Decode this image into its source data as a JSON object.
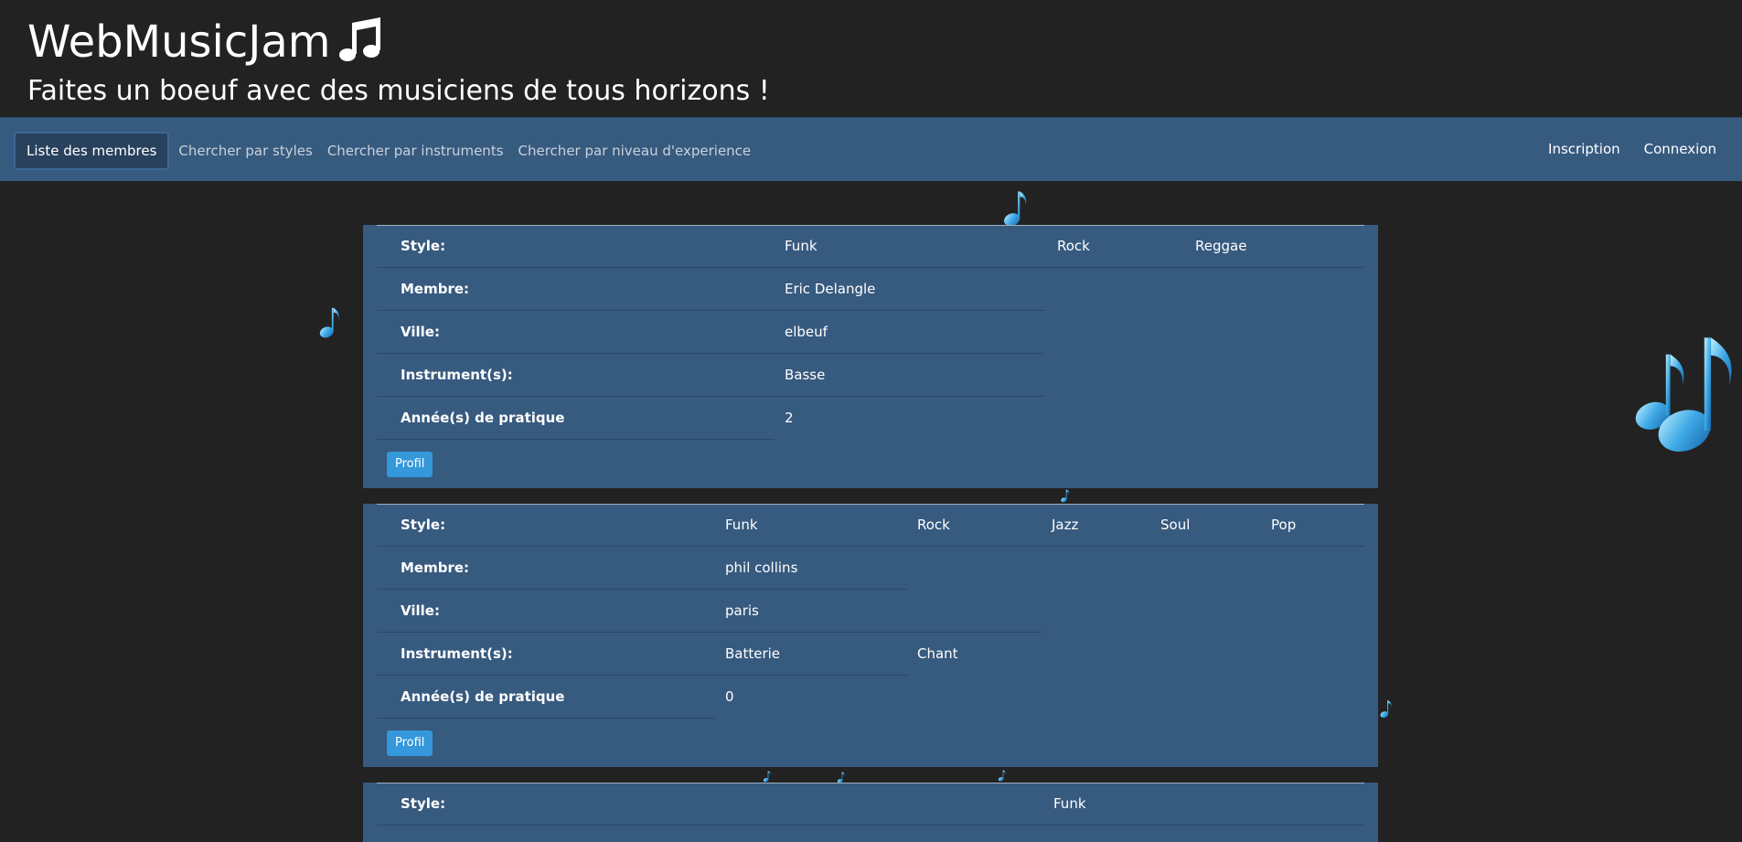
{
  "header": {
    "title": "WebMusicJam",
    "subtitle": "Faites un boeuf avec des musiciens de tous horizons !"
  },
  "nav": {
    "left": [
      "Liste des membres",
      "Chercher par styles",
      "Chercher par instruments",
      "Chercher par niveau d'experience"
    ],
    "right": [
      "Inscription",
      "Connexion"
    ]
  },
  "labels": {
    "style": "Style:",
    "membre": "Membre:",
    "ville": "Ville:",
    "instruments": "Instrument(s):",
    "annees": "Année(s) de pratique",
    "profil": "Profil"
  },
  "members": [
    {
      "styles": [
        "Funk",
        "Rock",
        "Reggae"
      ],
      "membre": "Eric Delangle",
      "ville": "elbeuf",
      "instruments": [
        "Basse"
      ],
      "annees": "2"
    },
    {
      "styles": [
        "Funk",
        "Rock",
        "Jazz",
        "Soul",
        "Pop"
      ],
      "membre": "phil collins",
      "ville": "paris",
      "instruments": [
        "Batterie",
        "Chant"
      ],
      "annees": "0"
    },
    {
      "styles": [
        "Funk"
      ]
    }
  ],
  "colors": {
    "background": "#222222",
    "navbar": "#375a7f",
    "card": "#375a7f",
    "button": "#3498db"
  },
  "icons": {
    "title_icon": "music-note-icon",
    "decor_icon": "blue-music-note-icon"
  }
}
